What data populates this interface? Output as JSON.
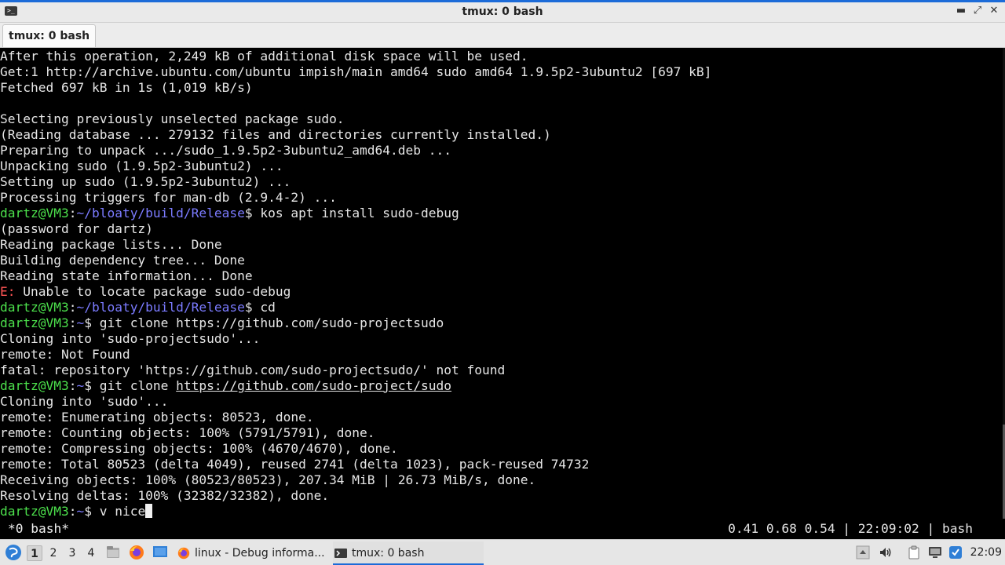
{
  "window": {
    "title": "tmux: 0 bash",
    "tab_label": "tmux: 0 bash",
    "app_icon_glyph": ">_",
    "minimize_glyph": "▬",
    "maximize_glyph": "⤢",
    "close_glyph": "✕"
  },
  "terminal": {
    "lines": [
      {
        "segments": [
          {
            "t": "After this operation, 2,249 kB of additional disk space will be used."
          }
        ]
      },
      {
        "segments": [
          {
            "t": "Get:1 http://archive.ubuntu.com/ubuntu impish/main amd64 sudo amd64 1.9.5p2-3ubuntu2 [697 kB]"
          }
        ]
      },
      {
        "segments": [
          {
            "t": "Fetched 697 kB in 1s (1,019 kB/s)"
          }
        ]
      },
      {
        "segments": [
          {
            "t": ""
          }
        ]
      },
      {
        "segments": [
          {
            "t": "Selecting previously unselected package sudo."
          }
        ]
      },
      {
        "segments": [
          {
            "t": "(Reading database ... 279132 files and directories currently installed.)"
          }
        ]
      },
      {
        "segments": [
          {
            "t": "Preparing to unpack .../sudo_1.9.5p2-3ubuntu2_amd64.deb ..."
          }
        ]
      },
      {
        "segments": [
          {
            "t": "Unpacking sudo (1.9.5p2-3ubuntu2) ..."
          }
        ]
      },
      {
        "segments": [
          {
            "t": "Setting up sudo (1.9.5p2-3ubuntu2) ..."
          }
        ]
      },
      {
        "segments": [
          {
            "t": "Processing triggers for man-db (2.9.4-2) ..."
          }
        ]
      },
      {
        "segments": [
          {
            "t": "dartz@VM3",
            "c": "user"
          },
          {
            "t": ":"
          },
          {
            "t": "~/bloaty/build/Release",
            "c": "path"
          },
          {
            "t": "$ kos apt install sudo-debug"
          }
        ]
      },
      {
        "segments": [
          {
            "t": "(password for dartz)"
          }
        ]
      },
      {
        "segments": [
          {
            "t": "Reading package lists... Done"
          }
        ]
      },
      {
        "segments": [
          {
            "t": "Building dependency tree... Done"
          }
        ]
      },
      {
        "segments": [
          {
            "t": "Reading state information... Done"
          }
        ]
      },
      {
        "segments": [
          {
            "t": "E:",
            "c": "err"
          },
          {
            "t": " Unable to locate package sudo-debug"
          }
        ]
      },
      {
        "segments": [
          {
            "t": "dartz@VM3",
            "c": "user"
          },
          {
            "t": ":"
          },
          {
            "t": "~/bloaty/build/Release",
            "c": "path"
          },
          {
            "t": "$ cd"
          }
        ]
      },
      {
        "segments": [
          {
            "t": "dartz@VM3",
            "c": "user"
          },
          {
            "t": ":"
          },
          {
            "t": "~",
            "c": "path"
          },
          {
            "t": "$ git clone https://github.com/sudo-projectsudo"
          }
        ]
      },
      {
        "segments": [
          {
            "t": "Cloning into 'sudo-projectsudo'..."
          }
        ]
      },
      {
        "segments": [
          {
            "t": "remote: Not Found"
          }
        ]
      },
      {
        "segments": [
          {
            "t": "fatal: repository 'https://github.com/sudo-projectsudo/' not found"
          }
        ]
      },
      {
        "segments": [
          {
            "t": "dartz@VM3",
            "c": "user"
          },
          {
            "t": ":"
          },
          {
            "t": "~",
            "c": "path"
          },
          {
            "t": "$ git clone "
          },
          {
            "t": "https://github.com/sudo-project/sudo",
            "c": "u"
          }
        ]
      },
      {
        "segments": [
          {
            "t": "Cloning into 'sudo'..."
          }
        ]
      },
      {
        "segments": [
          {
            "t": "remote: Enumerating objects: 80523, done."
          }
        ]
      },
      {
        "segments": [
          {
            "t": "remote: Counting objects: 100% (5791/5791), done."
          }
        ]
      },
      {
        "segments": [
          {
            "t": "remote: Compressing objects: 100% (4670/4670), done."
          }
        ]
      },
      {
        "segments": [
          {
            "t": "remote: Total 80523 (delta 4049), reused 2741 (delta 1023), pack-reused 74732"
          }
        ]
      },
      {
        "segments": [
          {
            "t": "Receiving objects: 100% (80523/80523), 207.34 MiB | 26.73 MiB/s, done."
          }
        ]
      },
      {
        "segments": [
          {
            "t": "Resolving deltas: 100% (32382/32382), done."
          }
        ]
      },
      {
        "segments": [
          {
            "t": "dartz@VM3",
            "c": "user"
          },
          {
            "t": ":"
          },
          {
            "t": "~",
            "c": "path"
          },
          {
            "t": "$ v nice"
          },
          {
            "t": "",
            "c": "cursor"
          }
        ]
      }
    ]
  },
  "tmux_status": {
    "left": "*0 bash*",
    "right": "0.41 0.68 0.54 | 22:09:02 | bash"
  },
  "taskbar": {
    "workspaces": [
      {
        "label": "1",
        "active": true
      },
      {
        "label": "2",
        "active": false
      },
      {
        "label": "3",
        "active": false
      },
      {
        "label": "4",
        "active": false
      }
    ],
    "launchers": [
      "file-manager-icon",
      "firefox-icon",
      "desktop-icon"
    ],
    "tasks": [
      {
        "label": "linux - Debug informa...",
        "icon": "firefox-icon"
      },
      {
        "label": "tmux: 0 bash",
        "icon": "terminal-icon"
      }
    ],
    "tray_icons": [
      "arrow-up-icon",
      "volume-icon",
      "clipboard-icon",
      "display-icon",
      "network-icon"
    ],
    "clock": "22:09"
  },
  "colors": {
    "prompt_user": "#4ce04c",
    "prompt_path": "#7b7bff",
    "error": "#ff5555",
    "accent": "#1c6bd8"
  }
}
